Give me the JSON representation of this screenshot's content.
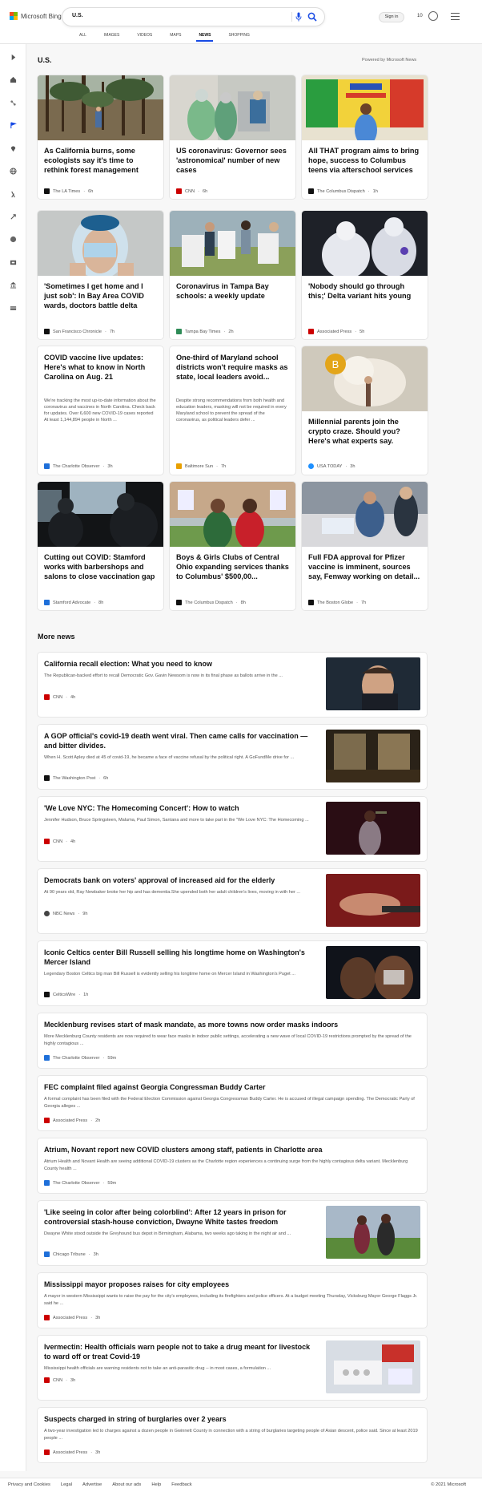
{
  "header": {
    "logo_text": "Microsoft Bing",
    "search_value": "U.S.",
    "signin_label": "Sign in",
    "reward_count": "10",
    "tabs": [
      {
        "label": "All"
      },
      {
        "label": "Images"
      },
      {
        "label": "Videos"
      },
      {
        "label": "Maps"
      },
      {
        "label": "News"
      },
      {
        "label": "Shopping"
      }
    ],
    "active_tab": "News"
  },
  "sidebar": {
    "icons": [
      "expand-icon",
      "home-icon",
      "recommended-icon",
      "flag-icon",
      "location-icon",
      "globe-icon",
      "science-icon",
      "rocket-icon",
      "globe-world-icon",
      "movie-icon",
      "bank-icon",
      "card-icon"
    ]
  },
  "top_section": {
    "title": "U.S.",
    "powered_by": "Powered by Microsoft News"
  },
  "cards": [
    {
      "title": "As California burns, some ecologists say it's time to rethink forest management",
      "source": "The LA Times",
      "time": "6h",
      "logo_color": "#111111"
    },
    {
      "title": "US coronavirus: Governor sees 'astronomical' number of new cases",
      "source": "CNN",
      "time": "6h",
      "logo_color": "#cc0000"
    },
    {
      "title": "All THAT program aims to bring hope, success to Columbus teens via afterschool services",
      "source": "The Columbus Dispatch",
      "time": "1h",
      "logo_color": "#111111"
    },
    {
      "title": "'Sometimes I get home and I just sob': In Bay Area COVID wards, doctors battle delta",
      "source": "San Francisco Chronicle",
      "time": "7h",
      "logo_color": "#111111"
    },
    {
      "title": "Coronavirus in Tampa Bay schools: a weekly update",
      "source": "Tampa Bay Times",
      "time": "2h",
      "logo_color": "#2e8b57"
    },
    {
      "title": "'Nobody should go through this;' Delta variant hits young",
      "source": "Associated Press",
      "time": "5h",
      "logo_color": "#cc0000"
    },
    {
      "title": "COVID vaccine live updates: Here's what to know in North Carolina on Aug. 21",
      "desc": "We're tracking the most up-to-date information about the coronavirus and vaccines in North Carolina. Check back for updates. Over 6,600 new COVID-19 cases reported At least 1,144,894 people in North ...",
      "source": "The Charlotte Observer",
      "time": "3h",
      "logo_color": "#1e6fd9"
    },
    {
      "title": "One-third of Maryland school districts won't require masks as state, local leaders avoid...",
      "desc": "Despite strong recommendations from both health and education leaders, masking will not be required in every Maryland school to prevent the spread of the coronavirus, as political leaders defer ...",
      "source": "Baltimore Sun",
      "time": "7h",
      "logo_color": "#e8a000"
    },
    {
      "title": "Millennial parents join the crypto craze. Should you? Here's what experts say.",
      "source": "USA TODAY",
      "time": "3h",
      "logo_color": "#1e90ff"
    },
    {
      "title": "Cutting out COVID: Stamford works with barbershops and salons to close vaccination gap",
      "source": "Stamford Advocate",
      "time": "8h",
      "logo_color": "#1e6fd9"
    },
    {
      "title": "Boys & Girls Clubs of Central Ohio expanding services thanks to Columbus' $500,00...",
      "source": "The Columbus Dispatch",
      "time": "8h",
      "logo_color": "#111111"
    },
    {
      "title": "Full FDA approval for Pfizer vaccine is imminent, sources say, Fenway working on detail...",
      "source": "The Boston Globe",
      "time": "7h",
      "logo_color": "#111111"
    }
  ],
  "more_news": {
    "title": "More news",
    "items": [
      {
        "title": "California recall election: What you need to know",
        "desc": "The Republican-backed effort to recall Democratic Gov. Gavin Newsom is now in its final phase as ballots arrive in the ...",
        "source": "CNN",
        "time": "4h",
        "logo_color": "#cc0000"
      },
      {
        "title": "A GOP official's covid-19 death went viral. Then came calls for vaccination — and bitter divides.",
        "desc": "When H. Scott Apley died at 45 of covid-19, he became a face of vaccine refusal by the political right. A GoFundMe drive for ...",
        "source": "The Washington Post",
        "time": "6h",
        "logo_color": "#111111"
      },
      {
        "title": "'We Love NYC: The Homecoming Concert': How to watch",
        "desc": "Jennifer Hudson, Bruce Springsteen, Maluma, Paul Simon, Santana and more to take part in the \"We Love NYC: The Homecoming ...",
        "source": "CNN",
        "time": "4h",
        "logo_color": "#cc0000"
      },
      {
        "title": "Democrats bank on voters' approval of increased aid for the elderly",
        "desc": "At 90 years old, Ray Newbaker broke her hip and has dementia.She upended both her adult children's lives, moving in with her ...",
        "source": "NBC News",
        "time": "9h",
        "logo_color": "#444444"
      },
      {
        "title": "Iconic Celtics center Bill Russell selling his longtime home on Washington's Mercer Island",
        "desc": "Legendary Boston Celtics big man Bill Russell is evidently selling his longtime home on Mercer Island in Washington's Puget ...",
        "source": "CelticsWire",
        "time": "1h",
        "logo_color": "#111111"
      },
      {
        "title": "Mecklenburg revises start of mask mandate, as more towns now order masks indoors",
        "desc": "More Mecklenburg County residents are now required to wear face masks in indoor public settings, accelerating a new wave of local COVID-19 restrictions prompted by the spread of the highly contagious ...",
        "source": "The Charlotte Observer",
        "time": "59m",
        "logo_color": "#1e6fd9"
      },
      {
        "title": "FEC complaint filed against Georgia Congressman Buddy Carter",
        "desc": "A formal complaint has been filed with the Federal Election Commission against Georgia Congressman Buddy Carter. He is accused of illegal campaign spending. The Democratic Party of Georgia alleges ...",
        "source": "Associated Press",
        "time": "2h",
        "logo_color": "#cc0000"
      },
      {
        "title": "Atrium, Novant report new COVID clusters among staff, patients in Charlotte area",
        "desc": "Atrium Health and Novant Health are seeing additional COVID-19 clusters as the Charlotte region experiences a continuing surge from the highly contagious delta variant. Mecklenburg County health ...",
        "source": "The Charlotte Observer",
        "time": "59m",
        "logo_color": "#1e6fd9"
      },
      {
        "title": "'Like seeing in color after being colorblind': After 12 years in prison for controversial stash-house conviction, Dwayne White tastes freedom",
        "desc": "Dwayne White stood outside the Greyhound bus depot in Birmingham, Alabama, two weeks ago taking in the night air and ...",
        "source": "Chicago Tribune",
        "time": "3h",
        "logo_color": "#1e6fd9"
      },
      {
        "title": "Mississippi mayor proposes raises for city employees",
        "desc": "A mayor in western Mississippi wants to raise the pay for the city's employees, including its firefighters and police officers. At a budget meeting Thursday, Vicksburg Mayor George Flaggs Jr. said he ...",
        "source": "Associated Press",
        "time": "3h",
        "logo_color": "#cc0000"
      },
      {
        "title": "Ivermectin: Health officials warn people not to take a drug meant for livestock to ward off or treat Covid-19",
        "desc": "Mississippi health officials are warning residents not to take an anti-parasitic drug -- in most cases, a formulation ...",
        "source": "CNN",
        "time": "3h",
        "logo_color": "#cc0000"
      },
      {
        "title": "Suspects charged in string of burglaries over 2 years",
        "desc": "A two-year investigation led to charges against a dozen people in Gwinnett County in connection with a string of burglaries targeting people of Asian descent, police said. Since at least 2019 people ...",
        "source": "Associated Press",
        "time": "3h",
        "logo_color": "#cc0000"
      }
    ]
  },
  "footer": {
    "links": [
      "Privacy and Cookies",
      "Legal",
      "Advertise",
      "About our ads",
      "Help",
      "Feedback"
    ],
    "copyright": "© 2021 Microsoft"
  }
}
